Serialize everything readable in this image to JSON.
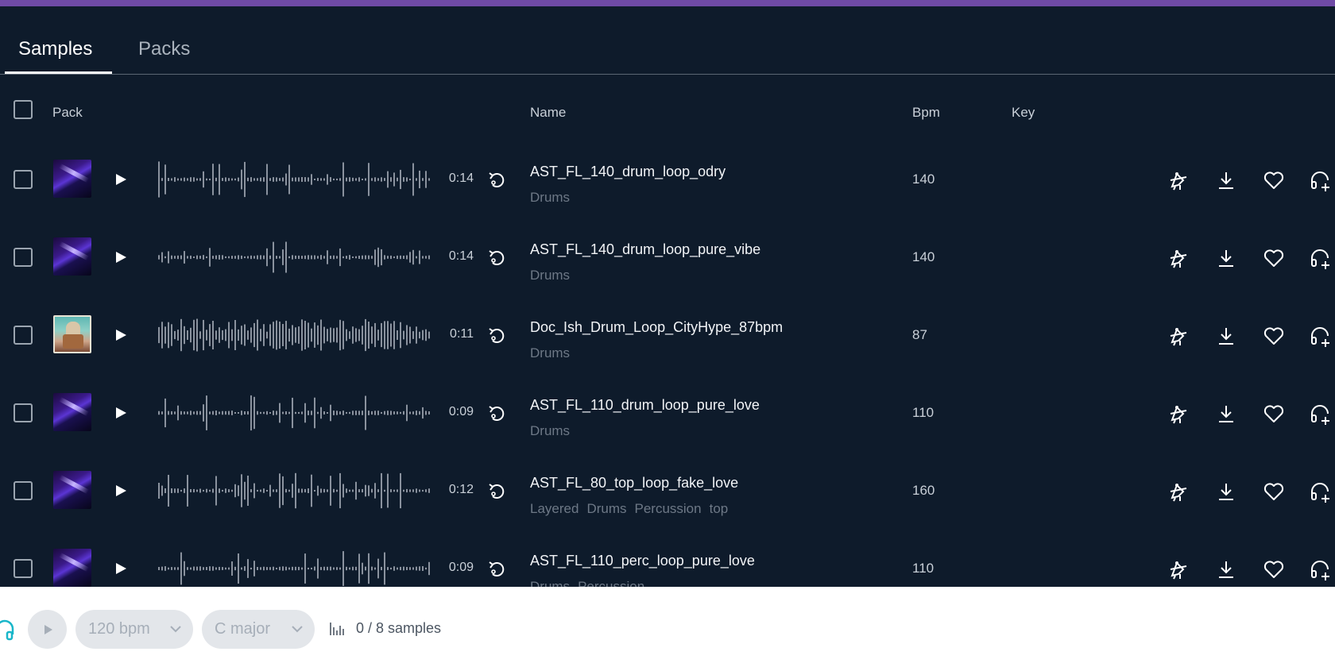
{
  "tabs": [
    {
      "label": "Samples",
      "active": true
    },
    {
      "label": "Packs",
      "active": false
    }
  ],
  "header": {
    "pack": "Pack",
    "name": "Name",
    "bpm": "Bpm",
    "key": "Key"
  },
  "rows": [
    {
      "art": "purple",
      "duration": "0:14",
      "name": "AST_FL_140_drum_loop_odry",
      "tags": [
        "Drums"
      ],
      "bpm": "140",
      "key": ""
    },
    {
      "art": "purple",
      "duration": "0:14",
      "name": "AST_FL_140_drum_loop_pure_vibe",
      "tags": [
        "Drums"
      ],
      "bpm": "140",
      "key": ""
    },
    {
      "art": "figure",
      "duration": "0:11",
      "name": "Doc_Ish_Drum_Loop_CityHype_87bpm",
      "tags": [
        "Drums"
      ],
      "bpm": "87",
      "key": ""
    },
    {
      "art": "purple",
      "duration": "0:09",
      "name": "AST_FL_110_drum_loop_pure_love",
      "tags": [
        "Drums"
      ],
      "bpm": "110",
      "key": ""
    },
    {
      "art": "purple",
      "duration": "0:12",
      "name": "AST_FL_80_top_loop_fake_love",
      "tags": [
        "Layered",
        "Drums",
        "Percussion",
        "top"
      ],
      "bpm": "160",
      "key": ""
    },
    {
      "art": "purple",
      "duration": "0:09",
      "name": "AST_FL_110_perc_loop_pure_love",
      "tags": [
        "Drums",
        "Percussion"
      ],
      "bpm": "110",
      "key": ""
    }
  ],
  "row_actions": [
    "find-similar-icon",
    "download-icon",
    "heart-icon",
    "headphones-plus-icon"
  ],
  "footer": {
    "bpm_label": "120 bpm",
    "key_label": "C major",
    "samples_count": "0 / 8 samples"
  },
  "colors": {
    "background": "#0e1b2b",
    "topbar": "#6f4aa6",
    "accent": "#18b6c9"
  }
}
